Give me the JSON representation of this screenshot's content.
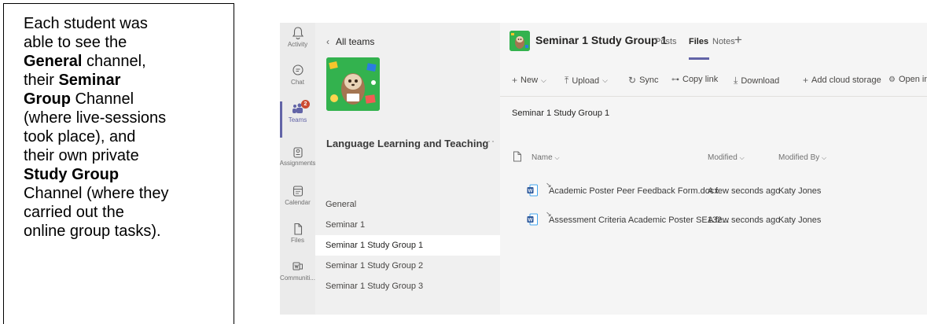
{
  "caption": {
    "line1": "Each student was",
    "line2": "able to see the",
    "general_bold": "General",
    "general_rest": " channel,",
    "their": "their ",
    "seminar_bold": "Seminar",
    "group_bold": "Group",
    "group_rest": " Channel",
    "live_line": "(where live-sessions",
    "took_line": "took place), and",
    "private_line": "their own private",
    "study_bold": "Study Group",
    "channel_line": "Channel (where they",
    "carried_line": "carried out the",
    "online_line": "online group tasks)."
  },
  "rail": {
    "items": [
      {
        "label": "Activity",
        "icon": "bell-icon"
      },
      {
        "label": "Chat",
        "icon": "chat-icon"
      },
      {
        "label": "Teams",
        "icon": "teams-icon",
        "badge": "2"
      },
      {
        "label": "Assignments",
        "icon": "assignments-icon"
      },
      {
        "label": "Calendar",
        "icon": "calendar-icon"
      },
      {
        "label": "Files",
        "icon": "files-icon"
      },
      {
        "label": "Communiti...",
        "icon": "communities-icon"
      }
    ]
  },
  "channels": {
    "back_label": "All teams",
    "team_name": "Language Learning and Teaching",
    "more": "···",
    "items": [
      {
        "label": "General"
      },
      {
        "label": "Seminar 1"
      },
      {
        "label": "Seminar 1 Study Group 1"
      },
      {
        "label": "Seminar 1 Study Group 2"
      },
      {
        "label": "Seminar 1 Study Group 3"
      }
    ]
  },
  "header": {
    "title": "Seminar 1 Study Group 1",
    "tabs": [
      {
        "label": "Posts"
      },
      {
        "label": "Files"
      },
      {
        "label": "Notes"
      }
    ],
    "add": "+"
  },
  "toolbar": {
    "new": "New",
    "upload": "Upload",
    "sync": "Sync",
    "copy_link": "Copy link",
    "download": "Download",
    "add_cloud": "Add cloud storage",
    "open_in": "Open in"
  },
  "files": {
    "breadcrumb": "Seminar 1 Study Group 1",
    "columns": {
      "name": "Name",
      "modified": "Modified",
      "modified_by": "Modified By"
    },
    "rows": [
      {
        "name": "Academic Poster Peer Feedback Form.docx",
        "modified": "A few seconds ago",
        "modified_by": "Katy Jones"
      },
      {
        "name": "Assessment Criteria Academic Poster SE132...",
        "modified": "A few seconds ago",
        "modified_by": "Katy Jones"
      }
    ]
  },
  "colors": {
    "accent": "#6264a7",
    "badge": "#cc4a31",
    "word_blue": "#2b579a"
  }
}
